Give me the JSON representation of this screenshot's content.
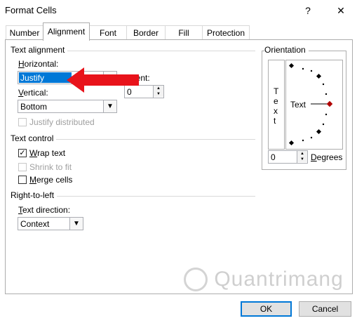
{
  "window": {
    "title": "Format Cells",
    "help_glyph": "?",
    "close_glyph": "✕"
  },
  "tabs": [
    {
      "label": "Number"
    },
    {
      "label": "Alignment"
    },
    {
      "label": "Font"
    },
    {
      "label": "Border"
    },
    {
      "label": "Fill"
    },
    {
      "label": "Protection"
    }
  ],
  "text_alignment": {
    "section": "Text alignment",
    "horizontal_label": "Horizontal:",
    "horizontal_value": "Justify",
    "indent_label": "Indent:",
    "indent_value": "0",
    "vertical_label": "Vertical:",
    "vertical_value": "Bottom",
    "justify_distributed": "Justify distributed"
  },
  "text_control": {
    "section": "Text control",
    "wrap_text": "Wrap text",
    "wrap_checked": true,
    "shrink_to_fit": "Shrink to fit",
    "merge_cells": "Merge cells"
  },
  "rtl": {
    "section": "Right-to-left",
    "direction_label": "Text direction:",
    "direction_value": "Context"
  },
  "orientation": {
    "section": "Orientation",
    "vertical_text": [
      "T",
      "e",
      "x",
      "t"
    ],
    "rotation_text": "Text",
    "degrees_value": "0",
    "degrees_label": "Degrees"
  },
  "buttons": {
    "ok": "OK",
    "cancel": "Cancel"
  },
  "watermark": "Quantrimang",
  "colors": {
    "arrow": "#e8131b",
    "accent": "#0078d7",
    "selected_bg": "#0078d7"
  }
}
